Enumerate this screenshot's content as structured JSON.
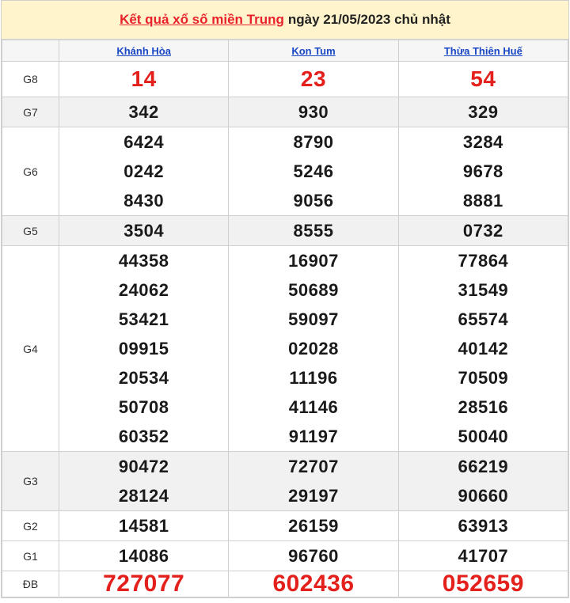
{
  "title": {
    "link_text": "Kết quả xổ số miền Trung",
    "rest_text": "ngày 21/05/2023 chủ nhật"
  },
  "provinces": [
    "Khánh Hòa",
    "Kon Tum",
    "Thừa Thiên Huế"
  ],
  "prizes": {
    "g8": {
      "label": "G8",
      "values": [
        [
          "14"
        ],
        [
          "23"
        ],
        [
          "54"
        ]
      ]
    },
    "g7": {
      "label": "G7",
      "values": [
        [
          "342"
        ],
        [
          "930"
        ],
        [
          "329"
        ]
      ]
    },
    "g6": {
      "label": "G6",
      "values": [
        [
          "6424",
          "0242",
          "8430"
        ],
        [
          "8790",
          "5246",
          "9056"
        ],
        [
          "3284",
          "9678",
          "8881"
        ]
      ]
    },
    "g5": {
      "label": "G5",
      "values": [
        [
          "3504"
        ],
        [
          "8555"
        ],
        [
          "0732"
        ]
      ]
    },
    "g4": {
      "label": "G4",
      "values": [
        [
          "44358",
          "24062",
          "53421",
          "09915",
          "20534",
          "50708",
          "60352"
        ],
        [
          "16907",
          "50689",
          "59097",
          "02028",
          "11196",
          "41146",
          "91197"
        ],
        [
          "77864",
          "31549",
          "65574",
          "40142",
          "70509",
          "28516",
          "50040"
        ]
      ]
    },
    "g3": {
      "label": "G3",
      "values": [
        [
          "90472",
          "28124"
        ],
        [
          "72707",
          "29197"
        ],
        [
          "66219",
          "90660"
        ]
      ]
    },
    "g2": {
      "label": "G2",
      "values": [
        [
          "14581"
        ],
        [
          "26159"
        ],
        [
          "63913"
        ]
      ]
    },
    "g1": {
      "label": "G1",
      "values": [
        [
          "14086"
        ],
        [
          "96760"
        ],
        [
          "41707"
        ]
      ]
    },
    "db": {
      "label": "ĐB",
      "values": [
        [
          "727077"
        ],
        [
          "602436"
        ],
        [
          "052659"
        ]
      ]
    }
  }
}
